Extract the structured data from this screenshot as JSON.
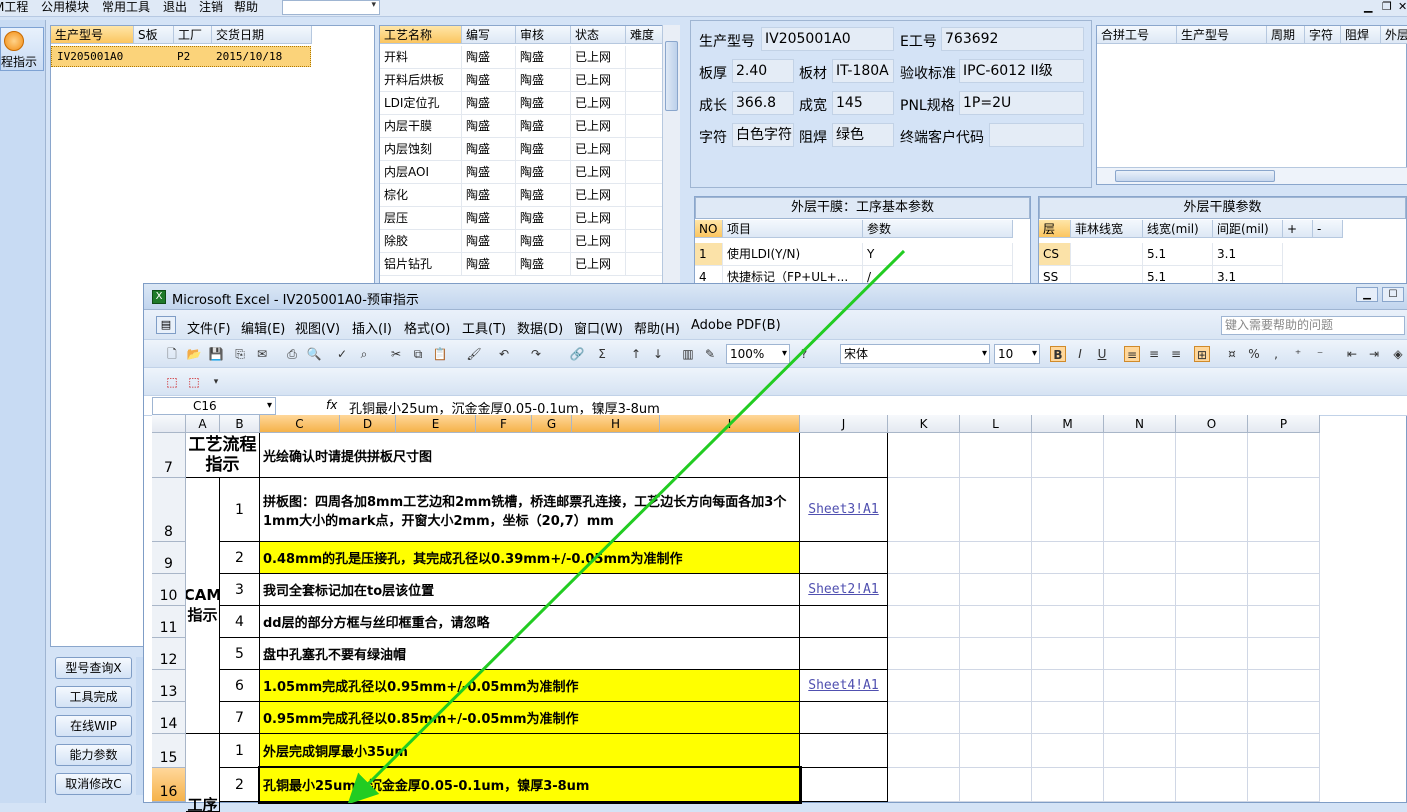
{
  "top_menu": {
    "items": [
      "M工程",
      "公用模块",
      "常用工具",
      "退出",
      "注销",
      "帮助"
    ]
  },
  "left_button": {
    "label": "程指示"
  },
  "order_grid": {
    "headers": [
      "生产型号",
      "S板",
      "工厂",
      "交货日期"
    ],
    "row": [
      "IV205001A0",
      "P2",
      "2015/10/18"
    ]
  },
  "left_buttons": [
    "型号查询X",
    "工具完成",
    "在线WIP",
    "能力参数",
    "取消修改C"
  ],
  "process_grid": {
    "headers": [
      "工艺名称",
      "编写",
      "审核",
      "状态",
      "难度"
    ],
    "rows": [
      [
        "开料",
        "陶盛",
        "陶盛",
        "已上网"
      ],
      [
        "开料后烘板",
        "陶盛",
        "陶盛",
        "已上网"
      ],
      [
        "LDI定位孔",
        "陶盛",
        "陶盛",
        "已上网"
      ],
      [
        "内层干膜",
        "陶盛",
        "陶盛",
        "已上网"
      ],
      [
        "内层蚀刻",
        "陶盛",
        "陶盛",
        "已上网"
      ],
      [
        "内层AOI",
        "陶盛",
        "陶盛",
        "已上网"
      ],
      [
        "棕化",
        "陶盛",
        "陶盛",
        "已上网"
      ],
      [
        "层压",
        "陶盛",
        "陶盛",
        "已上网"
      ],
      [
        "除胶",
        "陶盛",
        "陶盛",
        "已上网"
      ],
      [
        "铝片钻孔",
        "陶盛",
        "陶盛",
        "已上网"
      ]
    ]
  },
  "info": {
    "model_label": "生产型号",
    "model_value": "IV205001A0",
    "e_label": "E工号",
    "e_value": "763692",
    "thickness_label": "板厚",
    "thickness_value": "2.40",
    "material_label": "板材",
    "material_value": "IT-180A",
    "standard_label": "验收标准",
    "standard_value": "IPC-6012 II级",
    "length_label": "成长",
    "length_value": "366.8",
    "width_label": "成宽",
    "width_value": "145",
    "pnl_label": "PNL规格",
    "pnl_value": "1P=2U",
    "char_label": "字符",
    "char_value": "白色字符",
    "mask_label": "阻焊",
    "mask_value": "绿色",
    "customer_label": "终端客户代码",
    "customer_value": ""
  },
  "merge_grid": {
    "headers": [
      "合拼工号",
      "生产型号",
      "周期",
      "字符",
      "阻焊",
      "外层"
    ]
  },
  "outer_basic": {
    "title": "外层干膜：工序基本参数",
    "headers": [
      "NO",
      "项目",
      "参数"
    ],
    "rows": [
      [
        "1",
        "使用LDI(Y/N)",
        "Y"
      ],
      [
        "4",
        "快捷标记（FP+UL+...",
        "/"
      ]
    ]
  },
  "outer_params": {
    "title": "外层干膜参数",
    "headers": [
      "层",
      "菲林线宽",
      "线宽(mil)",
      "间距(mil)",
      "+",
      "-"
    ],
    "rows": [
      [
        "CS",
        "",
        "5.1",
        "3.1"
      ],
      [
        "SS",
        "",
        "5.1",
        "3.1"
      ]
    ]
  },
  "excel": {
    "title": "Microsoft Excel - IV205001A0-预审指示",
    "menus": [
      "文件(F)",
      "编辑(E)",
      "视图(V)",
      "插入(I)",
      "格式(O)",
      "工具(T)",
      "数据(D)",
      "窗口(W)",
      "帮助(H)",
      "Adobe PDF(B)"
    ],
    "help_placeholder": "键入需要帮助的问题",
    "zoom": "100%",
    "font": "宋体",
    "font_size": "10",
    "name_box": "C16",
    "formula": "孔铜最小25um，沉金金厚0.05-0.1um，镍厚3-8um",
    "columns": [
      "A",
      "B",
      "C",
      "D",
      "E",
      "F",
      "G",
      "H",
      "I",
      "J",
      "K",
      "L",
      "M",
      "N",
      "O",
      "P"
    ],
    "rows": [
      {
        "num": "7",
        "a": "工艺流程\n指示",
        "b": "",
        "text": "光绘确认时请提供拼板尺寸图",
        "link": ""
      },
      {
        "num": "8",
        "a": "",
        "b": "1",
        "text": "拼板图：四周各加8mm工艺边和2mm铣槽，桥连邮票孔连接，工艺边长方向每面各加3个1mm大小的mark点，开窗大小2mm，坐标（20,7）mm",
        "link": "Sheet3!A1"
      },
      {
        "num": "9",
        "a": "",
        "b": "2",
        "text": "0.48mm的孔是压接孔，其完成孔径以0.39mm+/-0.05mm为准制作",
        "link": ""
      },
      {
        "num": "10",
        "a": "",
        "b": "3",
        "text": "我司全套标记加在to层该位置",
        "link": "Sheet2!A1"
      },
      {
        "num": "11",
        "a": "",
        "b": "4",
        "text": "dd层的部分方框与丝印框重合，请忽略",
        "link": ""
      },
      {
        "num": "12",
        "a": "",
        "b": "5",
        "text": "盘中孔塞孔不要有绿油帽",
        "link": ""
      },
      {
        "num": "13",
        "a": "",
        "b": "6",
        "text": "1.05mm完成孔径以0.95mm+/-0.05mm为准制作",
        "link": "Sheet4!A1"
      },
      {
        "num": "14",
        "a": "",
        "b": "7",
        "text": "0.95mm完成孔径以0.85mm+/-0.05mm为准制作",
        "link": ""
      },
      {
        "num": "15",
        "a": "",
        "b": "1",
        "text": "外层完成铜厚最小35um",
        "link": ""
      },
      {
        "num": "16",
        "a": "",
        "b": "2",
        "text": "孔铜最小25um，沉金金厚0.05-0.1um，镍厚3-8um",
        "link": ""
      }
    ],
    "cam_label": "CAM\n指示",
    "row16_partial": "工序"
  }
}
